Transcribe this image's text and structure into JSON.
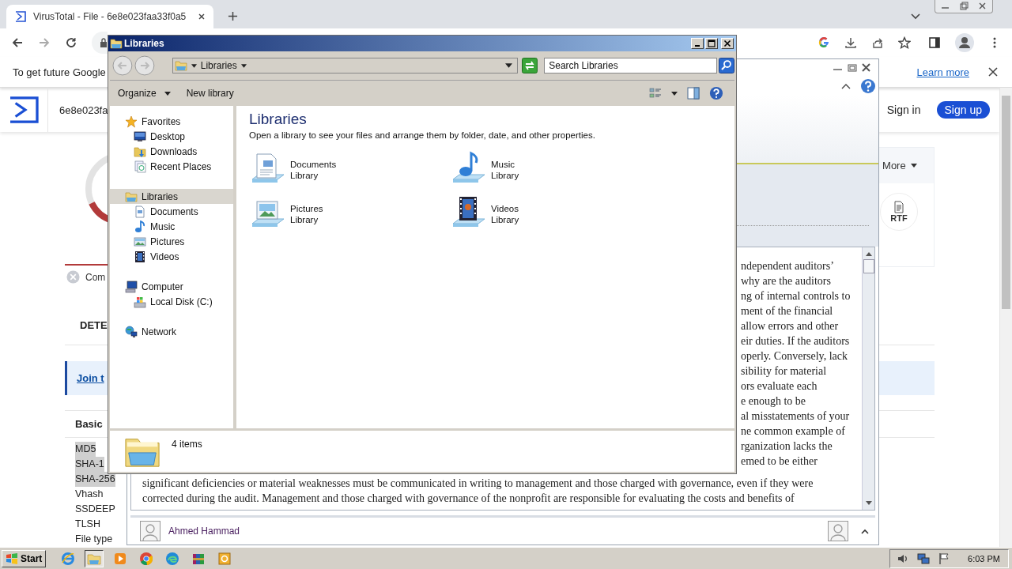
{
  "browser": {
    "tab": {
      "title": "VirusTotal - File - 6e8e023faa33f0a5"
    },
    "infobar": {
      "text": "To get future Google",
      "link": "Learn more"
    },
    "page": {
      "hash": "6e8e023fa",
      "sign_in": "Sign in",
      "sign_up": "Sign up",
      "status_label": "Com",
      "tab_label": "DETE",
      "join_link": "Join t",
      "section_title": "Basic",
      "more": "More",
      "file_badge": "RTF",
      "properties": [
        {
          "label": "MD5",
          "selected": true
        },
        {
          "label": "SHA-1",
          "selected": true
        },
        {
          "label": "SHA-256",
          "selected": true
        },
        {
          "label": "Vhash",
          "selected": false
        },
        {
          "label": "SSDEEP",
          "selected": false
        },
        {
          "label": "TLSH",
          "selected": false
        },
        {
          "label": "File type",
          "selected": false
        }
      ]
    }
  },
  "document_window": {
    "lines_partial": [
      "ndependent auditors’",
      "why are the auditors",
      "ng of internal controls to",
      "ment of the financial",
      "allow errors and other",
      "eir duties. If the auditors",
      "operly. Conversely, lack",
      "sibility for material",
      "ors evaluate each",
      "e enough to be",
      "al misstatements of your",
      "ne common example of",
      "rganization lacks the",
      "emed to be either"
    ],
    "lines_full": [
      "significant deficiencies or material weaknesses must be communicated in writing to management and those charged with governance, even if they were",
      "corrected during the audit. Management and those charged with governance of the nonprofit are responsible for evaluating the costs and benefits of"
    ],
    "author": "Ahmed Hammad"
  },
  "explorer": {
    "title": "Libraries",
    "breadcrumb": "Libraries",
    "search": {
      "placeholder": "Search Libraries"
    },
    "toolbar": [
      {
        "label": "Organize",
        "kind": "menu"
      },
      {
        "label": "New library",
        "kind": "button"
      }
    ],
    "nav": [
      {
        "label": "Favorites",
        "kind": "favorites",
        "selected": false,
        "children": [
          {
            "label": "Desktop",
            "kind": "desktop",
            "selected": false
          },
          {
            "label": "Downloads",
            "kind": "downloads",
            "selected": false
          },
          {
            "label": "Recent Places",
            "kind": "recent",
            "selected": false
          }
        ]
      },
      {
        "label": "Libraries",
        "kind": "libraries",
        "selected": true,
        "children": [
          {
            "label": "Documents",
            "kind": "documents",
            "selected": false
          },
          {
            "label": "Music",
            "kind": "music",
            "selected": false
          },
          {
            "label": "Pictures",
            "kind": "pictures",
            "selected": false
          },
          {
            "label": "Videos",
            "kind": "videos",
            "selected": false
          }
        ]
      },
      {
        "label": "Computer",
        "kind": "computer",
        "selected": false,
        "children": [
          {
            "label": "Local Disk (C:)",
            "kind": "disk",
            "selected": false
          }
        ]
      },
      {
        "label": "Network",
        "kind": "network",
        "selected": false
      }
    ],
    "heading": "Libraries",
    "description": "Open a library to see your files and arrange them by folder, date, and other properties.",
    "libraries": [
      {
        "name": "Documents",
        "subtitle": "Library",
        "kind": "documents"
      },
      {
        "name": "Music",
        "subtitle": "Library",
        "kind": "music"
      },
      {
        "name": "Pictures",
        "subtitle": "Library",
        "kind": "pictures"
      },
      {
        "name": "Videos",
        "subtitle": "Library",
        "kind": "videos"
      }
    ],
    "status": "4 items"
  },
  "taskbar": {
    "start": "Start",
    "apps": [
      {
        "kind": "ie",
        "active": false
      },
      {
        "kind": "explorer",
        "active": true
      },
      {
        "kind": "media",
        "active": false
      },
      {
        "kind": "chrome",
        "active": false
      },
      {
        "kind": "edge",
        "active": false
      },
      {
        "kind": "archive",
        "active": false
      },
      {
        "kind": "office",
        "active": false
      }
    ],
    "time": "6:03 PM"
  }
}
